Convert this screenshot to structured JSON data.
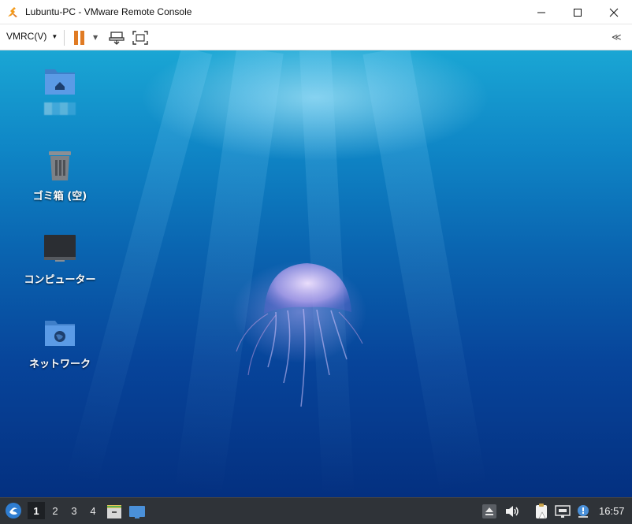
{
  "window": {
    "title": "Lubuntu-PC - VMware Remote Console"
  },
  "toolbar": {
    "vmrc_menu_label": "VMRC(V)",
    "collapse_label": "≪"
  },
  "desktop": {
    "icons": [
      {
        "label": "",
        "icon": "home-folder-icon"
      },
      {
        "label": "ゴミ箱 (空)",
        "icon": "trash-icon"
      },
      {
        "label": "コンピューター",
        "icon": "computer-icon"
      },
      {
        "label": "ネットワーク",
        "icon": "network-folder-icon"
      }
    ]
  },
  "panel": {
    "workspaces": [
      "1",
      "2",
      "3",
      "4"
    ],
    "active_workspace": "1",
    "clock": "16:57"
  },
  "colors": {
    "pause_accent": "#e07b24",
    "panel_bg": "#2f3338",
    "folder_blue": "#4a90d9"
  }
}
